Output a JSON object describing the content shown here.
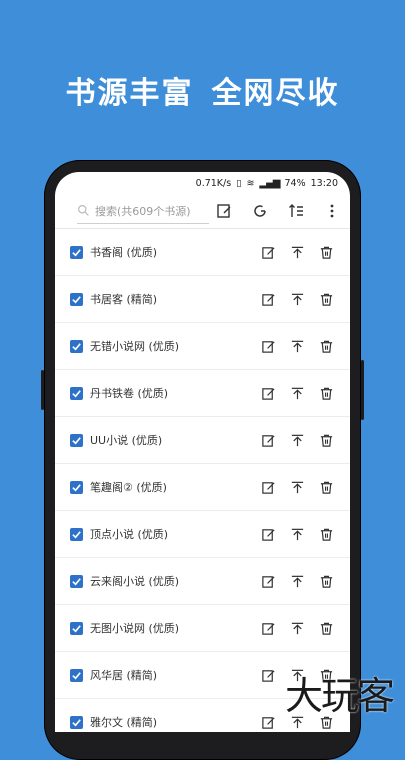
{
  "headline": {
    "left": "书源丰富",
    "right": "全网尽收"
  },
  "status": {
    "speed": "0.71K/s",
    "battery": "74%",
    "time": "13:20"
  },
  "toolbar": {
    "search_placeholder": "搜索(共609个书源)"
  },
  "sources": [
    {
      "name": "书香阁 (优质)"
    },
    {
      "name": "书居客 (精简)"
    },
    {
      "name": "无错小说网 (优质)"
    },
    {
      "name": "丹书铁卷 (优质)"
    },
    {
      "name": "UU小说 (优质)"
    },
    {
      "name": "笔趣阁② (优质)"
    },
    {
      "name": "顶点小说 (优质)"
    },
    {
      "name": "云来阁小说 (优质)"
    },
    {
      "name": "无图小说网 (优质)"
    },
    {
      "name": "风华居 (精简)"
    },
    {
      "name": "雅尔文 (精简)"
    }
  ],
  "watermark": "大玩客",
  "colors": {
    "background": "#3f8ed9",
    "checkbox": "#2d72c8"
  }
}
